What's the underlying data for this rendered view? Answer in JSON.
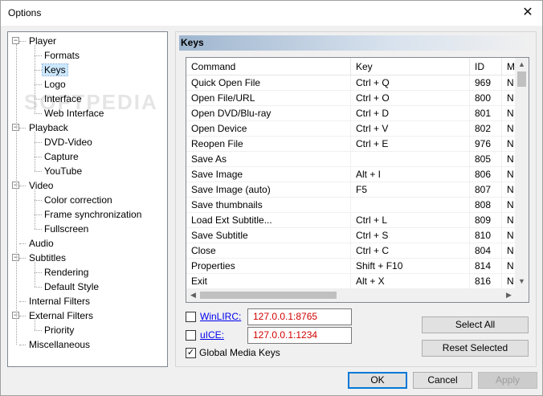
{
  "window": {
    "title": "Options",
    "close_glyph": "✕"
  },
  "watermark": "SOFTPEDIA",
  "tree": [
    {
      "label": "Player",
      "level": 0,
      "expander": "−",
      "name": "player"
    },
    {
      "label": "Formats",
      "level": 1,
      "name": "formats"
    },
    {
      "label": "Keys",
      "level": 1,
      "selected": true,
      "name": "keys"
    },
    {
      "label": "Logo",
      "level": 1,
      "name": "logo"
    },
    {
      "label": "Interface",
      "level": 1,
      "name": "interface"
    },
    {
      "label": "Web Interface",
      "level": 1,
      "name": "web-interface"
    },
    {
      "label": "Playback",
      "level": 0,
      "expander": "−",
      "name": "playback"
    },
    {
      "label": "DVD-Video",
      "level": 1,
      "name": "dvd-video"
    },
    {
      "label": "Capture",
      "level": 1,
      "name": "capture"
    },
    {
      "label": "YouTube",
      "level": 1,
      "name": "youtube"
    },
    {
      "label": "Video",
      "level": 0,
      "expander": "−",
      "name": "video"
    },
    {
      "label": "Color correction",
      "level": 1,
      "name": "color-correction"
    },
    {
      "label": "Frame synchronization",
      "level": 1,
      "name": "frame-synchronization"
    },
    {
      "label": "Fullscreen",
      "level": 1,
      "name": "fullscreen"
    },
    {
      "label": "Audio",
      "level": 0,
      "name": "audio"
    },
    {
      "label": "Subtitles",
      "level": 0,
      "expander": "−",
      "name": "subtitles"
    },
    {
      "label": "Rendering",
      "level": 1,
      "name": "rendering"
    },
    {
      "label": "Default Style",
      "level": 1,
      "name": "default-style"
    },
    {
      "label": "Internal Filters",
      "level": 0,
      "name": "internal-filters"
    },
    {
      "label": "External Filters",
      "level": 0,
      "expander": "−",
      "name": "external-filters"
    },
    {
      "label": "Priority",
      "level": 1,
      "name": "priority"
    },
    {
      "label": "Miscellaneous",
      "level": 0,
      "name": "miscellaneous"
    }
  ],
  "keys_panel": {
    "header": "Keys",
    "columns": [
      "Command",
      "Key",
      "ID",
      "M"
    ],
    "rows": [
      [
        "Quick Open File",
        "Ctrl + Q",
        "969",
        "N"
      ],
      [
        "Open File/URL",
        "Ctrl + O",
        "800",
        "N"
      ],
      [
        "Open DVD/Blu-ray",
        "Ctrl + D",
        "801",
        "N"
      ],
      [
        "Open Device",
        "Ctrl + V",
        "802",
        "N"
      ],
      [
        "Reopen File",
        "Ctrl + E",
        "976",
        "N"
      ],
      [
        "Save As",
        "",
        "805",
        "N"
      ],
      [
        "Save Image",
        "Alt + I",
        "806",
        "N"
      ],
      [
        "Save Image (auto)",
        "F5",
        "807",
        "N"
      ],
      [
        "Save thumbnails",
        "",
        "808",
        "N"
      ],
      [
        "Load Ext Subtitle...",
        "Ctrl + L",
        "809",
        "N"
      ],
      [
        "Save Subtitle",
        "Ctrl + S",
        "810",
        "N"
      ],
      [
        "Close",
        "Ctrl + C",
        "804",
        "N"
      ],
      [
        "Properties",
        "Shift + F10",
        "814",
        "N"
      ],
      [
        "Exit",
        "Alt + X",
        "816",
        "N"
      ]
    ],
    "scroll_glyphs": {
      "up": "▲",
      "down": "▼",
      "left": "◀",
      "right": "▶"
    },
    "winlirc": {
      "label": "WinLIRC:",
      "checked": false,
      "value": "127.0.0.1:8765"
    },
    "uice": {
      "label": "uICE:",
      "checked": false,
      "value": "127.0.0.1:1234"
    },
    "global_media_keys": {
      "label": "Global Media Keys",
      "checked": true,
      "mark": "✓"
    },
    "select_all": "Select All",
    "reset_selected": "Reset Selected"
  },
  "footer": {
    "ok": "OK",
    "cancel": "Cancel",
    "apply": "Apply"
  }
}
